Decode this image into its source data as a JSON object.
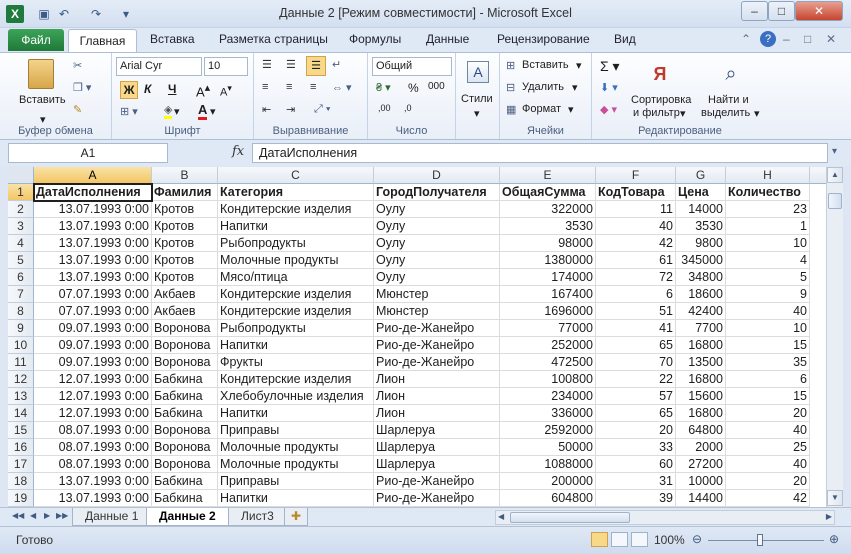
{
  "window": {
    "title": "Данные 2  [Режим совместимости]  -  Microsoft Excel"
  },
  "ribbon_tabs": [
    "Файл",
    "Главная",
    "Вставка",
    "Разметка страницы",
    "Формулы",
    "Данные",
    "Рецензирование",
    "Вид"
  ],
  "ribbon": {
    "clipboard": {
      "paste": "Вставить",
      "label": "Буфер обмена"
    },
    "font": {
      "name": "Arial Cyr",
      "size": "10",
      "label": "Шрифт",
      "bold": "Ж",
      "italic": "К",
      "underline": "Ч"
    },
    "alignment": {
      "label": "Выравнивание"
    },
    "number": {
      "format": "Общий",
      "label": "Число"
    },
    "styles": {
      "styles_btn": "Стили"
    },
    "cells": {
      "insert": "Вставить",
      "delete": "Удалить",
      "format": "Формат",
      "label": "Ячейки"
    },
    "editing": {
      "sort": "Сортировка",
      "sort2": "и фильтр",
      "find": "Найти и",
      "find2": "выделить",
      "label": "Редактирование"
    }
  },
  "formula_bar": {
    "name_box": "A1",
    "fx": "fx",
    "formula": "ДатаИсполнения"
  },
  "grid": {
    "columns": [
      "A",
      "B",
      "C",
      "D",
      "E",
      "F",
      "G",
      "H"
    ],
    "rows": [
      [
        "ДатаИсполнения",
        "Фамилия",
        "Категория",
        "ГородПолучателя",
        "ОбщаяСумма",
        "КодТовара",
        "Цена",
        "Количество"
      ],
      [
        "13.07.1993 0:00",
        "Кротов",
        "Кондитерские изделия",
        "Оулу",
        "322000",
        "11",
        "14000",
        "23"
      ],
      [
        "13.07.1993 0:00",
        "Кротов",
        "Напитки",
        "Оулу",
        "3530",
        "40",
        "3530",
        "1"
      ],
      [
        "13.07.1993 0:00",
        "Кротов",
        "Рыбопродукты",
        "Оулу",
        "98000",
        "42",
        "9800",
        "10"
      ],
      [
        "13.07.1993 0:00",
        "Кротов",
        "Молочные продукты",
        "Оулу",
        "1380000",
        "61",
        "345000",
        "4"
      ],
      [
        "13.07.1993 0:00",
        "Кротов",
        "Мясо/птица",
        "Оулу",
        "174000",
        "72",
        "34800",
        "5"
      ],
      [
        "07.07.1993 0:00",
        "Акбаев",
        "Кондитерские изделия",
        "Мюнстер",
        "167400",
        "6",
        "18600",
        "9"
      ],
      [
        "07.07.1993 0:00",
        "Акбаев",
        "Кондитерские изделия",
        "Мюнстер",
        "1696000",
        "51",
        "42400",
        "40"
      ],
      [
        "09.07.1993 0:00",
        "Воронова",
        "Рыбопродукты",
        "Рио-де-Жанейро",
        "77000",
        "41",
        "7700",
        "10"
      ],
      [
        "09.07.1993 0:00",
        "Воронова",
        "Напитки",
        "Рио-де-Жанейро",
        "252000",
        "65",
        "16800",
        "15"
      ],
      [
        "09.07.1993 0:00",
        "Воронова",
        "Фрукты",
        "Рио-де-Жанейро",
        "472500",
        "70",
        "13500",
        "35"
      ],
      [
        "12.07.1993 0:00",
        "Бабкина",
        "Кондитерские изделия",
        "Лион",
        "100800",
        "22",
        "16800",
        "6"
      ],
      [
        "12.07.1993 0:00",
        "Бабкина",
        "Хлебобулочные изделия",
        "Лион",
        "234000",
        "57",
        "15600",
        "15"
      ],
      [
        "12.07.1993 0:00",
        "Бабкина",
        "Напитки",
        "Лион",
        "336000",
        "65",
        "16800",
        "20"
      ],
      [
        "08.07.1993 0:00",
        "Воронова",
        "Приправы",
        "Шарлеруа",
        "2592000",
        "20",
        "64800",
        "40"
      ],
      [
        "08.07.1993 0:00",
        "Воронова",
        "Молочные продукты",
        "Шарлеруа",
        "50000",
        "33",
        "2000",
        "25"
      ],
      [
        "08.07.1993 0:00",
        "Воронова",
        "Молочные продукты",
        "Шарлеруа",
        "1088000",
        "60",
        "27200",
        "40"
      ],
      [
        "13.07.1993 0:00",
        "Бабкина",
        "Приправы",
        "Рио-де-Жанейро",
        "200000",
        "31",
        "10000",
        "20"
      ],
      [
        "13.07.1993 0:00",
        "Бабкина",
        "Напитки",
        "Рио-де-Жанейро",
        "604800",
        "39",
        "14400",
        "42"
      ]
    ],
    "row_numbers": [
      "1",
      "2",
      "3",
      "4",
      "5",
      "6",
      "7",
      "8",
      "9",
      "10",
      "11",
      "12",
      "13",
      "14",
      "15",
      "16",
      "17",
      "18",
      "19"
    ]
  },
  "sheets": [
    "Данные 1",
    "Данные 2",
    "Лист3"
  ],
  "active_sheet": "Данные 2",
  "status": {
    "ready": "Готово",
    "zoom": "100%"
  },
  "colors": {
    "accent": "#1f7a38",
    "selection": "#f3c566"
  }
}
